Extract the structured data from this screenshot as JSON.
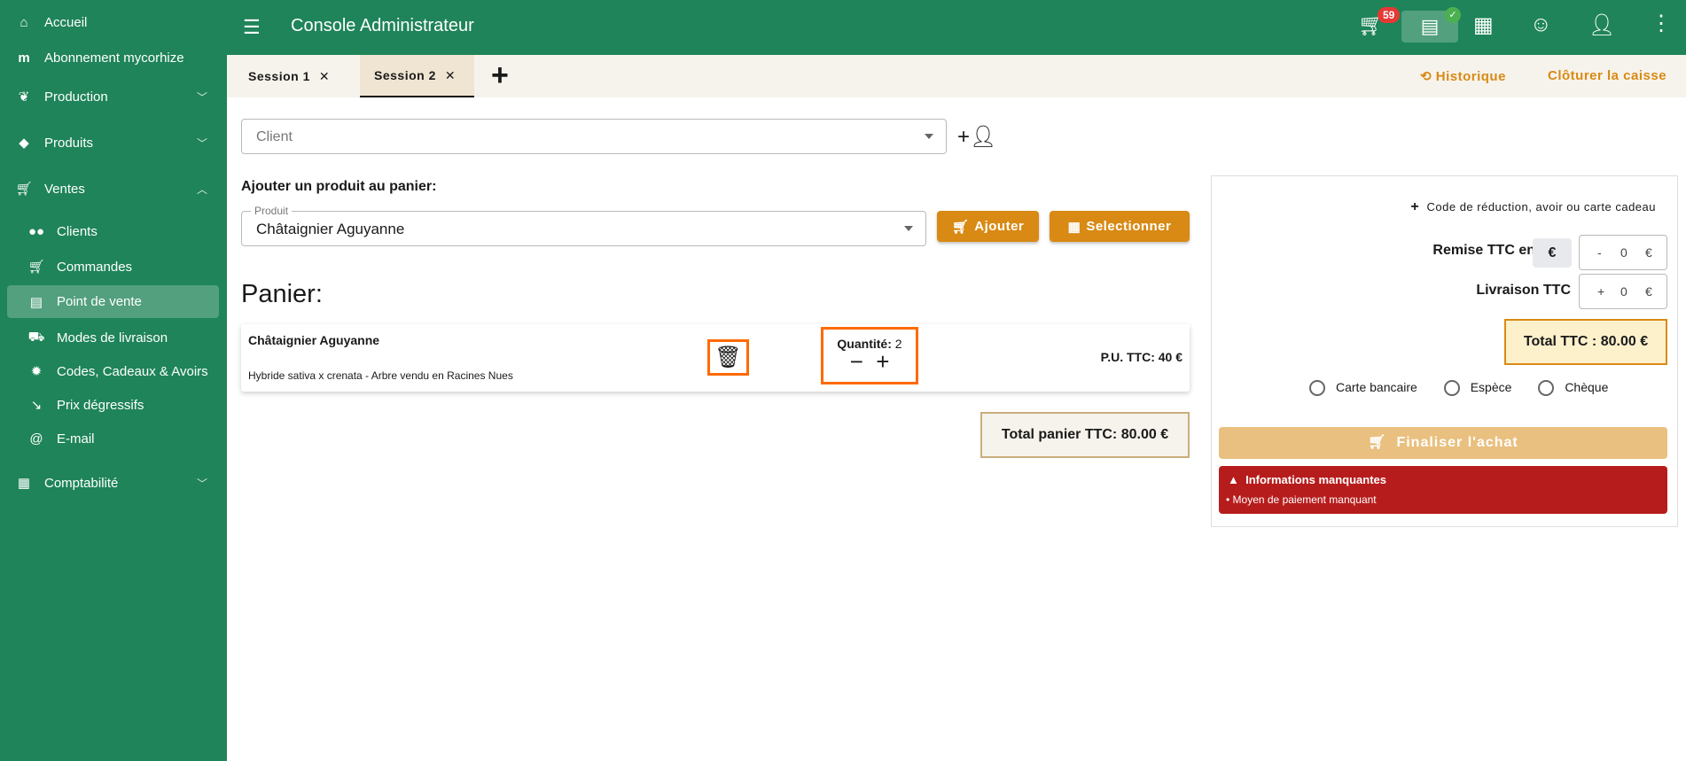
{
  "sidebar": {
    "items": [
      {
        "label": "Accueil",
        "icon": "home-icon"
      },
      {
        "label": "Abonnement mycorhize",
        "icon": "mycorhize-logo-icon"
      },
      {
        "label": "Production",
        "icon": "sprout-icon"
      },
      {
        "label": "Produits",
        "icon": "tags-icon"
      },
      {
        "label": "Ventes",
        "icon": "cart-icon"
      },
      {
        "label": "Clients",
        "icon": "users-icon"
      },
      {
        "label": "Commandes",
        "icon": "cart-icon"
      },
      {
        "label": "Point de vente",
        "icon": "cash-register-icon"
      },
      {
        "label": "Modes de livraison",
        "icon": "truck-icon"
      },
      {
        "label": "Codes, Cadeaux & Avoirs",
        "icon": "discount-icon"
      },
      {
        "label": "Prix dégressifs",
        "icon": "stairs-down-icon"
      },
      {
        "label": "E-mail",
        "icon": "at-icon"
      },
      {
        "label": "Comptabilité",
        "icon": "calculator-icon"
      }
    ]
  },
  "header": {
    "title": "Console Administrateur",
    "cart_badge": "59"
  },
  "tabs": {
    "items": [
      "Session 1",
      "Session 2"
    ],
    "active": "Session 2",
    "close": "✕",
    "add": "+"
  },
  "actions": {
    "history": "Historique",
    "close_register": "Clôturer la caisse"
  },
  "client": {
    "placeholder": "Client"
  },
  "add_product": {
    "heading": "Ajouter un produit au panier:",
    "label": "Produit",
    "value": "Châtaignier Aguyanne",
    "add_button": "Ajouter",
    "select_button": "Selectionner"
  },
  "cart": {
    "heading": "Panier:",
    "items": [
      {
        "name": "Châtaignier Aguyanne",
        "description": "Hybride sativa x crenata - Arbre vendu en Racines Nues",
        "quantity_label": "Quantité:",
        "quantity": "2",
        "unit_price": "P.U. TTC: 40 €"
      }
    ],
    "total": "Total panier TTC: 80.00 €"
  },
  "summary": {
    "code_link": "Code de réduction, avoir ou carte cadeau",
    "discount_label": "Remise TTC en",
    "discount_unit": "€",
    "discount_sign": "-",
    "discount_value": "0",
    "delivery_label": "Livraison TTC",
    "delivery_sign": "+",
    "delivery_value": "0",
    "currency": "€",
    "total": "Total TTC : 80.00 €",
    "payment_methods": [
      "Carte bancaire",
      "Espèce",
      "Chèque"
    ],
    "finalize": "Finaliser l'achat",
    "alert_title": "Informations manquantes",
    "alert_items": [
      "• Moyen de paiement manquant"
    ]
  },
  "colors": {
    "primary": "#1f8459",
    "accent": "#d88a14",
    "danger": "#b71c1c",
    "highlight": "#ff6a00"
  }
}
